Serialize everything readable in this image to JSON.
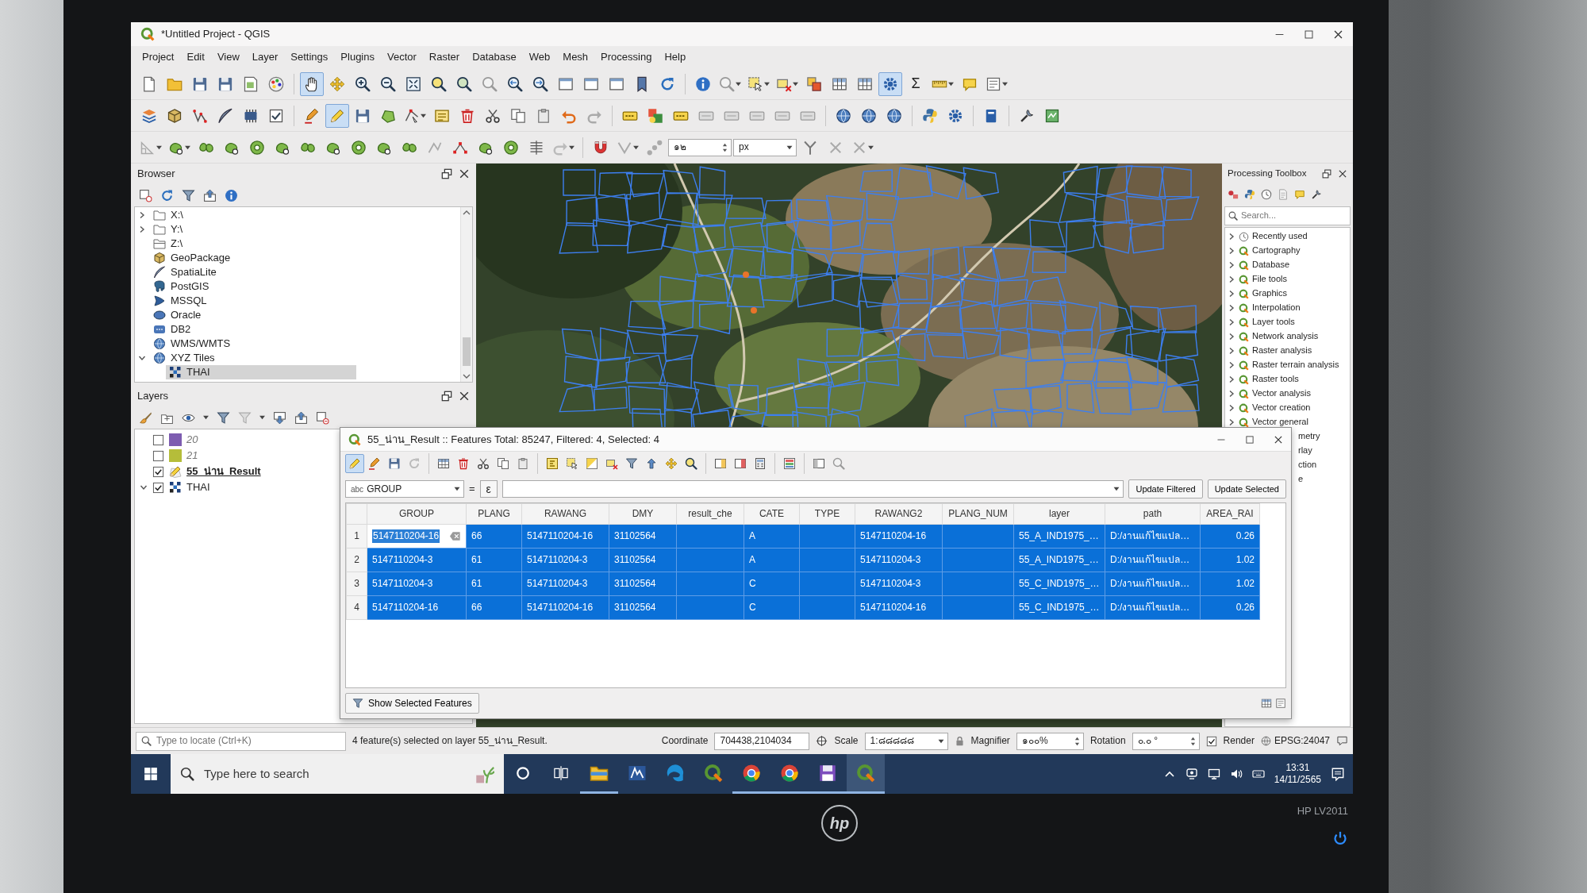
{
  "window": {
    "title": "*Untitled Project - QGIS"
  },
  "menu": [
    "Project",
    "Edit",
    "View",
    "Layer",
    "Settings",
    "Plugins",
    "Vector",
    "Raster",
    "Database",
    "Web",
    "Mesh",
    "Processing",
    "Help"
  ],
  "toolbars": [
    {
      "tools": [
        {
          "on": false
        },
        {
          "on": false
        },
        {
          "on": false
        },
        {
          "on": false
        },
        {
          "on": false
        },
        {
          "on": false
        },
        {
          "on": true
        },
        {
          "on": false
        },
        {
          "on": false
        },
        {
          "on": false
        },
        {
          "on": false
        },
        {
          "on": false
        },
        {
          "on": false
        },
        {
          "on": false
        },
        {
          "on": false
        },
        {
          "on": false
        },
        {
          "on": false
        },
        {
          "on": false
        },
        {
          "on": false
        },
        {
          "on": false
        },
        {
          "on": false
        },
        {
          "on": false
        },
        {
          "on": false
        },
        {
          "on": false
        },
        {
          "on": false
        },
        {
          "on": false
        },
        {
          "on": false
        },
        {
          "on": false
        },
        {
          "on": true
        },
        {
          "on": false,
          "label": "Σ"
        },
        {
          "on": false
        },
        {
          "on": false
        },
        {
          "on": false
        }
      ]
    },
    {
      "tools": [
        {
          "on": false
        },
        {
          "on": false
        },
        {
          "on": false
        },
        {
          "on": false
        },
        {
          "on": false
        },
        {
          "on": false
        },
        {
          "on": false
        },
        {
          "on": true
        },
        {
          "on": false
        },
        {
          "on": false
        },
        {
          "on": false
        },
        {
          "on": false
        },
        {
          "on": false
        },
        {
          "on": false
        },
        {
          "on": false
        },
        {
          "on": false
        },
        {
          "on": false
        },
        {
          "on": false
        },
        {
          "on": false
        },
        {
          "on": false
        },
        {
          "on": false
        },
        {
          "on": false
        },
        {
          "on": false
        },
        {
          "on": false
        },
        {
          "on": false
        },
        {
          "on": false
        },
        {
          "on": false
        },
        {
          "on": false
        },
        {
          "on": false
        },
        {
          "on": false
        },
        {
          "on": false
        },
        {
          "on": false
        },
        {
          "on": false
        },
        {
          "on": false
        }
      ]
    },
    {
      "tools": [
        {
          "on": false
        },
        {
          "on": false
        },
        {
          "on": false
        },
        {
          "on": false
        },
        {
          "on": false
        },
        {
          "on": false
        },
        {
          "on": false
        },
        {
          "on": false
        },
        {
          "on": false
        },
        {
          "on": false
        },
        {
          "on": false
        },
        {
          "on": false
        },
        {
          "on": false
        },
        {
          "on": false
        },
        {
          "on": false
        },
        {
          "on": false
        },
        {
          "on": false
        },
        {
          "on": false
        },
        {
          "on": false
        },
        {
          "on": false
        }
      ],
      "snapping_tolerance": "๑๒",
      "snapping_units": "px",
      "tools_after": [
        {
          "on": false
        },
        {
          "on": false
        },
        {
          "on": false
        }
      ]
    }
  ],
  "browser": {
    "title": "Browser",
    "items": [
      {
        "label": "X:\\",
        "kind": "drive",
        "expanded": false,
        "selected": false
      },
      {
        "label": "Y:\\",
        "kind": "drive",
        "expanded": false,
        "selected": false
      },
      {
        "label": "Z:\\",
        "kind": "network-drive",
        "selected": false
      },
      {
        "label": "GeoPackage",
        "kind": "geopackage",
        "selected": false
      },
      {
        "label": "SpatiaLite",
        "kind": "spatialite",
        "selected": false
      },
      {
        "label": "PostGIS",
        "kind": "postgis",
        "selected": false
      },
      {
        "label": "MSSQL",
        "kind": "mssql",
        "selected": false
      },
      {
        "label": "Oracle",
        "kind": "oracle",
        "selected": false
      },
      {
        "label": "DB2",
        "kind": "db2",
        "selected": false
      },
      {
        "label": "WMS/WMTS",
        "kind": "wms",
        "selected": false
      },
      {
        "label": "XYZ Tiles",
        "kind": "xyz",
        "expanded": true,
        "selected": false,
        "children": [
          {
            "label": "THAI",
            "kind": "tiles",
            "selected": true
          }
        ]
      }
    ]
  },
  "layers": {
    "title": "Layers",
    "items": [
      {
        "name": "20",
        "kind": "polygon",
        "visible": false,
        "editing": false,
        "active": false,
        "color": "#7d5cb0"
      },
      {
        "name": "21",
        "kind": "polygon",
        "visible": false,
        "editing": false,
        "active": false,
        "color": "#b5bd3a"
      },
      {
        "name": "55_น่าน_Result",
        "kind": "polygon",
        "visible": true,
        "editing": true,
        "active": true
      },
      {
        "name": "THAI",
        "kind": "tiles",
        "visible": true,
        "editing": false,
        "active": false,
        "expanded": true
      }
    ]
  },
  "processing_toolbox": {
    "title": "Processing Toolbox",
    "search": {
      "placeholder": "Search..."
    },
    "items": [
      {
        "label": "Recently used",
        "kind": "recent",
        "expanded": false
      },
      {
        "label": "Cartography",
        "kind": "provider",
        "expanded": false
      },
      {
        "label": "Database",
        "kind": "provider",
        "expanded": false
      },
      {
        "label": "File tools",
        "kind": "provider",
        "expanded": false
      },
      {
        "label": "Graphics",
        "kind": "provider",
        "expanded": false
      },
      {
        "label": "Interpolation",
        "kind": "provider",
        "expanded": false
      },
      {
        "label": "Layer tools",
        "kind": "provider",
        "expanded": false
      },
      {
        "label": "Network analysis",
        "kind": "provider",
        "expanded": false
      },
      {
        "label": "Raster analysis",
        "kind": "provider",
        "expanded": false
      },
      {
        "label": "Raster terrain analysis",
        "kind": "provider",
        "expanded": false
      },
      {
        "label": "Raster tools",
        "kind": "provider",
        "expanded": false
      },
      {
        "label": "Vector analysis",
        "kind": "provider",
        "expanded": false
      },
      {
        "label": "Vector creation",
        "kind": "provider",
        "expanded": false
      },
      {
        "label": "Vector general",
        "kind": "provider",
        "expanded": false
      },
      {
        "label": "metry",
        "kind": "covered"
      },
      {
        "label": "rlay",
        "kind": "covered"
      },
      {
        "label": "ction",
        "kind": "covered"
      },
      {
        "label": "e",
        "kind": "covered"
      }
    ]
  },
  "attribute_table": {
    "title": "55_น่าน_Result :: Features Total: 85247, Filtered: 4, Selected: 4",
    "tools": [
      {
        "on": true
      },
      {
        "on": false
      },
      {
        "on": false
      },
      {
        "on": false
      },
      {
        "on": false
      },
      {
        "on": false
      },
      {
        "on": false
      },
      {
        "on": false
      },
      {
        "on": false
      },
      {
        "on": false
      },
      {
        "on": false
      },
      {
        "on": false
      },
      {
        "on": false
      },
      {
        "on": false
      },
      {
        "on": false
      },
      {
        "on": false
      },
      {
        "on": false
      },
      {
        "on": false
      },
      {
        "on": false
      },
      {
        "on": false
      },
      {
        "on": false
      },
      {
        "on": false
      },
      {
        "on": false
      }
    ],
    "filter": {
      "field_type": "abc",
      "field": "GROUP",
      "operator": "=",
      "expression_button": "ε"
    },
    "update_buttons": [
      "Update Filtered",
      "Update Selected"
    ],
    "columns": [
      "GROUP",
      "PLANG",
      "RAWANG",
      "DMY",
      "result_che",
      "CATE",
      "TYPE",
      "RAWANG2",
      "PLANG_NUM",
      "layer",
      "path",
      "AREA_RAI"
    ],
    "rows": [
      {
        "number": "1",
        "selected": true,
        "editing": true,
        "cells": [
          "5147110204-16",
          "66",
          "5147110204-16",
          "31102564",
          null,
          "A",
          null,
          "5147110204-16",
          null,
          "55_A_IND1975_…",
          "D:/งานแก้ไขแปล…",
          "0.26"
        ]
      },
      {
        "number": "2",
        "selected": true,
        "editing": false,
        "cells": [
          "5147110204-3",
          "61",
          "5147110204-3",
          "31102564",
          null,
          "A",
          null,
          "5147110204-3",
          null,
          "55_A_IND1975_…",
          "D:/งานแก้ไขแปล…",
          "1.02"
        ]
      },
      {
        "number": "3",
        "selected": true,
        "editing": false,
        "cells": [
          "5147110204-3",
          "61",
          "5147110204-3",
          "31102564",
          null,
          "C",
          null,
          "5147110204-3",
          null,
          "55_C_IND1975_…",
          "D:/งานแก้ไขแปล…",
          "1.02"
        ]
      },
      {
        "number": "4",
        "selected": true,
        "editing": false,
        "cells": [
          "5147110204-16",
          "66",
          "5147110204-16",
          "31102564",
          null,
          "C",
          null,
          "5147110204-16",
          null,
          "55_C_IND1975_…",
          "D:/งานแก้ไขแปล…",
          "0.26"
        ]
      }
    ],
    "show_selected_button": "Show Selected Features"
  },
  "status_bar": {
    "locator": {
      "placeholder": "Type to locate (Ctrl+K)"
    },
    "message": "4 feature(s) selected on layer 55_น่าน_Result.",
    "coordinate": {
      "label": "Coordinate",
      "value": "704438,2104034"
    },
    "scale": {
      "label": "Scale",
      "value": "1:๘๘๘๘๘"
    },
    "magnifier": {
      "label": "Magnifier",
      "value": "๑๐๐%"
    },
    "rotation": {
      "label": "Rotation",
      "value": "๐.๐ °"
    },
    "render": {
      "label": "Render",
      "checked": true
    },
    "crs": "EPSG:24047"
  },
  "taskbar": {
    "search": {
      "placeholder": "Type here to search"
    },
    "apps": [
      {
        "running": true,
        "active": false
      },
      {
        "running": false,
        "active": false
      },
      {
        "running": false,
        "active": false
      },
      {
        "running": false,
        "active": false
      },
      {
        "running": true,
        "active": false
      },
      {
        "running": true,
        "active": false
      },
      {
        "running": true,
        "active": false
      },
      {
        "running": true,
        "active": true
      }
    ],
    "time": "13:31",
    "date": "14/11/2565"
  },
  "monitor": {
    "logo": "hp",
    "model": "HP LV2011",
    "power_on": true
  }
}
